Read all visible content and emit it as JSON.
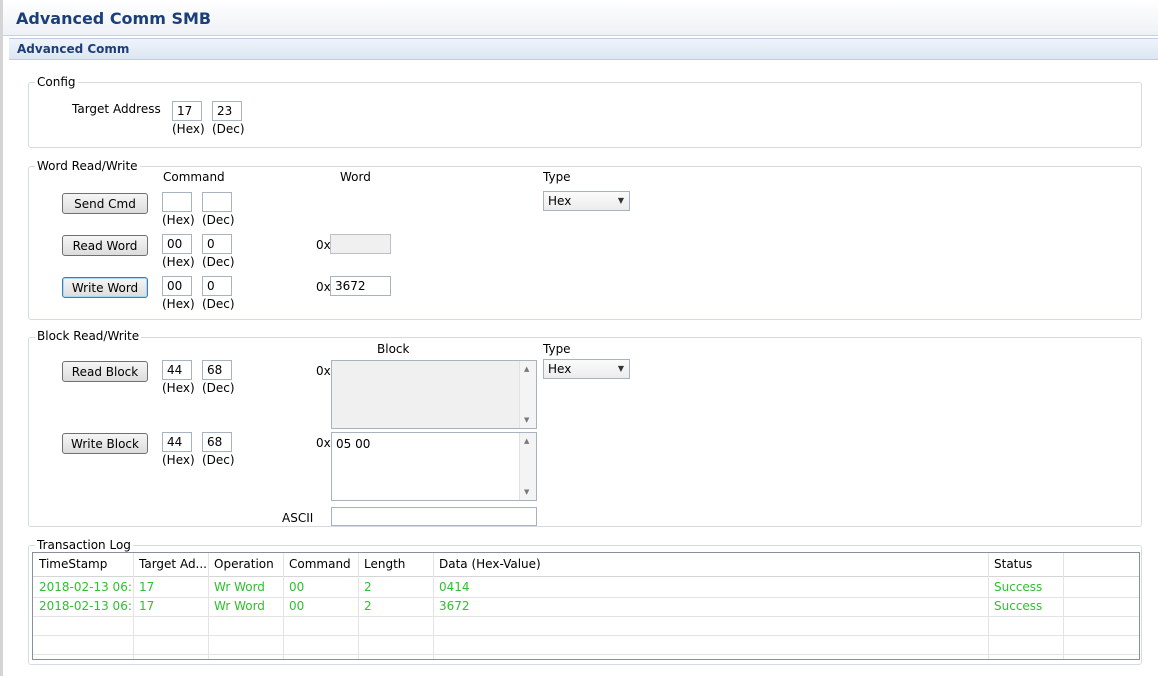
{
  "window": {
    "title": "Advanced Comm SMB"
  },
  "section": {
    "title": "Advanced Comm"
  },
  "config": {
    "title": "Config",
    "target_address_label": "Target Address",
    "hex_value": "17",
    "dec_value": "23",
    "hex_label": "(Hex)",
    "dec_label": "(Dec)"
  },
  "word": {
    "title": "Word Read/Write",
    "command_header": "Command",
    "word_header": "Word",
    "type_header": "Type",
    "type_value": "Hex",
    "prefix": "0x",
    "hex_label": "(Hex)",
    "dec_label": "(Dec)",
    "send_cmd": {
      "label": "Send Cmd",
      "hex": "",
      "dec": ""
    },
    "read_word": {
      "label": "Read Word",
      "hex": "00",
      "dec": "0",
      "value": ""
    },
    "write_word": {
      "label": "Write Word",
      "hex": "00",
      "dec": "0",
      "value": "3672"
    }
  },
  "block": {
    "title": "Block Read/Write",
    "block_header": "Block",
    "type_header": "Type",
    "type_value": "Hex",
    "prefix": "0x",
    "hex_label": "(Hex)",
    "dec_label": "(Dec)",
    "ascii_label": "ASCII",
    "ascii_value": "",
    "read_block": {
      "label": "Read Block",
      "hex": "44",
      "dec": "68",
      "value": ""
    },
    "write_block": {
      "label": "Write Block",
      "hex": "44",
      "dec": "68",
      "value": "05 00"
    }
  },
  "log": {
    "title": "Transaction Log",
    "columns": [
      "TimeStamp",
      "Target Ad...",
      "Operation",
      "Command",
      "Length",
      "Data (Hex-Value)",
      "Status"
    ],
    "rows": [
      [
        "2018-02-13 06:...",
        "17",
        "Wr Word",
        "00",
        "2",
        "0414",
        "Success"
      ],
      [
        "2018-02-13 06:...",
        "17",
        "Wr Word",
        "00",
        "2",
        "3672",
        "Success"
      ]
    ],
    "row_color": "#2ec12e"
  },
  "colors": {
    "title": "#1c3f78",
    "success": "#2ec12e"
  }
}
